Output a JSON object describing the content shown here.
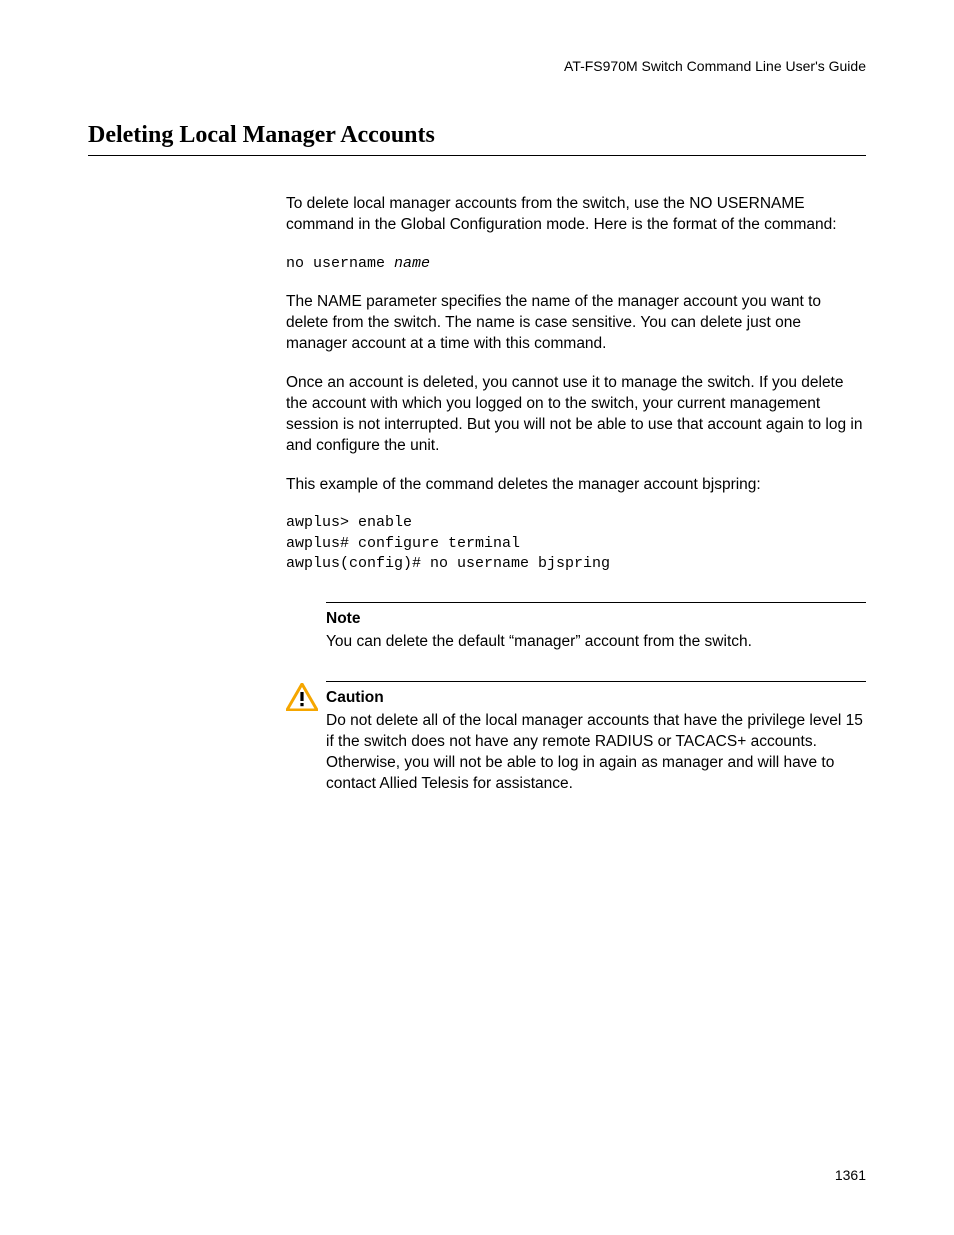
{
  "header": {
    "guide_title": "AT-FS970M Switch Command Line User's Guide"
  },
  "section": {
    "title": "Deleting Local Manager Accounts"
  },
  "body": {
    "para1": "To delete local manager accounts from the switch, use the NO USERNAME command in the Global Configuration mode. Here is the format of the command:",
    "cmd_format_prefix": "no username ",
    "cmd_format_param": "name",
    "para2": "The NAME parameter specifies the name of the manager account you want to delete from the switch. The name is case sensitive. You can delete just one manager account at a time with this command.",
    "para3": "Once an account is deleted, you cannot use it to manage the switch. If you delete the account with which you logged on to the switch, your current management session is not interrupted. But you will not be able to use that account again to log in and configure the unit.",
    "para4": "This example of the command deletes the manager account bjspring:",
    "example": "awplus> enable\nawplus# configure terminal\nawplus(config)# no username bjspring",
    "note_title": "Note",
    "note_body": "You can delete the default “manager” account from the switch.",
    "caution_title": "Caution",
    "caution_body": "Do not delete all of the local manager accounts that have the privilege level 15 if the switch does not have any remote RADIUS or TACACS+ accounts. Otherwise, you will not be able to log in again as manager and will have to contact Allied Telesis for assistance."
  },
  "footer": {
    "page_number": "1361"
  }
}
